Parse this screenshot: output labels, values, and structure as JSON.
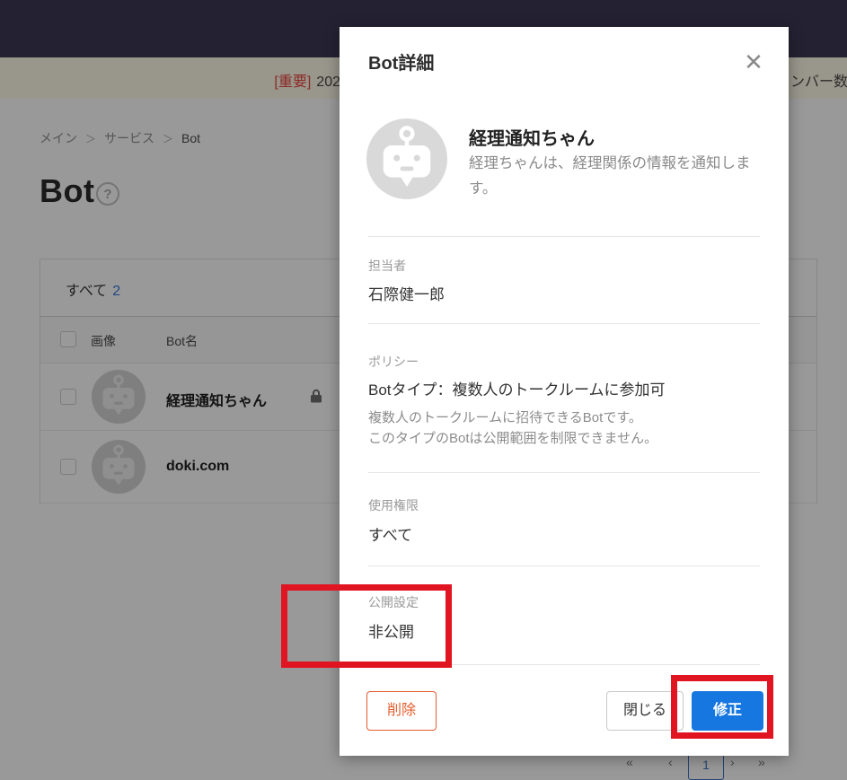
{
  "banner": {
    "important_label": "[重要]",
    "left_text": "202",
    "right_text": "ンバー数"
  },
  "breadcrumb": {
    "separator": "＞",
    "items": [
      "メイン",
      "サービス",
      "Bot"
    ]
  },
  "page": {
    "title": "Bot",
    "help_icon": "?"
  },
  "table": {
    "tab_all_label": "すべて",
    "tab_all_count": "2",
    "columns": {
      "image": "画像",
      "name": "Bot名"
    },
    "rows": [
      {
        "name": "経理通知ちゃん",
        "locked": true
      },
      {
        "name": "doki.com",
        "locked": false
      }
    ]
  },
  "pagination": {
    "first": "«",
    "prev": "‹",
    "current": "1",
    "next": "›",
    "last": "»"
  },
  "modal": {
    "title": "Bot詳細",
    "close_icon": "✕",
    "bot": {
      "name": "経理通知ちゃん",
      "description": "経理ちゃんは、経理関係の情報を通知します。"
    },
    "sections": [
      {
        "label": "担当者",
        "value": "石際健一郎"
      },
      {
        "label": "ポリシー",
        "value": "Botタイプ：複数人のトークルームに参加可",
        "notes": [
          "複数人のトークルームに招待できるBotです。",
          "このタイプのBotは公開範囲を制限できません。"
        ]
      },
      {
        "label": "使用権限",
        "value": "すべて"
      },
      {
        "label": "公開設定",
        "value": "非公開"
      }
    ],
    "buttons": {
      "delete": "削除",
      "close": "閉じる",
      "edit": "修正"
    }
  },
  "colors": {
    "accent_blue": "#1677e0",
    "delete_orange": "#e55c2c",
    "annotation_red": "#e11422",
    "link_blue": "#3a77d8",
    "banner_important_red": "#e9453c",
    "topbar_navy": "#3c3a54"
  }
}
